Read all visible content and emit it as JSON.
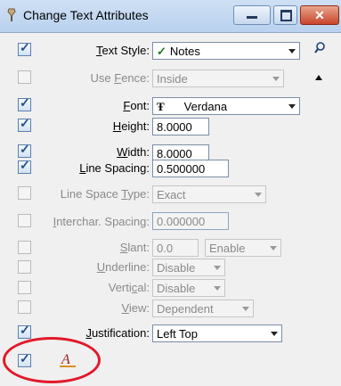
{
  "window": {
    "title": "Change Text Attributes",
    "close_glyph": "✕"
  },
  "rows": {
    "text_style": {
      "label": "Text Style:",
      "value": "Notes",
      "value_icon": "✓"
    },
    "use_fence": {
      "label": "Use Fence:",
      "value": "Inside"
    },
    "font": {
      "label": "Font:",
      "value": "Verdana",
      "value_icon": "Ŧ"
    },
    "height": {
      "label": "Height:",
      "value": "8.0000"
    },
    "width": {
      "label": "Width:",
      "value": "8.0000"
    },
    "line_spacing": {
      "label": "Line Spacing:",
      "value": "0.500000"
    },
    "line_space_type": {
      "label": "Line Space Type:",
      "value": "Exact"
    },
    "interchar_spacing": {
      "label": "Interchar. Spacing:",
      "value": "0.000000"
    },
    "slant": {
      "label": "Slant:",
      "value": "0.0",
      "enable": "Enable"
    },
    "underline": {
      "label": "Underline:",
      "value": "Disable"
    },
    "vertical": {
      "label": "Vertical:",
      "value": "Disable"
    },
    "view": {
      "label": "View:",
      "value": "Dependent"
    },
    "justification": {
      "label": "Justification:",
      "value": "Left Top"
    }
  },
  "icons": {
    "window": "brush-icon",
    "search": "magnifier-icon",
    "collapse": "triangle-up-icon",
    "text_attr": "text-attribute-icon"
  },
  "colors": {
    "highlight_circle": "#e1192a",
    "checkbox_tick": "#244f8c"
  }
}
